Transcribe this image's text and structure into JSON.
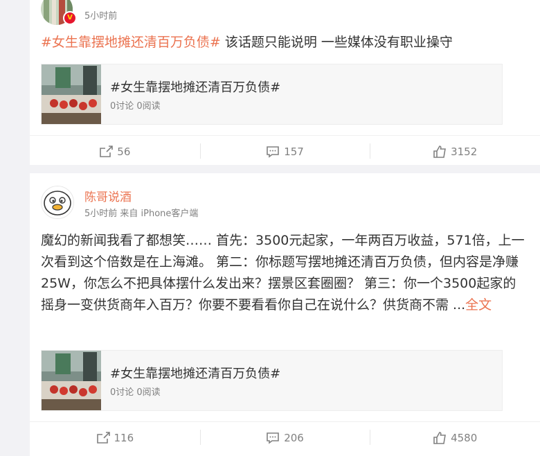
{
  "post1": {
    "time": "5小时前",
    "topic": "#女生靠摆地摊还清百万负债#",
    "text": " 该话题只能说明 一些媒体没有职业操守",
    "card": {
      "title": "#女生靠摆地摊还清百万负债#",
      "sub": "0讨论 0阅读"
    },
    "actions": {
      "repost": "56",
      "comment": "157",
      "like": "3152"
    }
  },
  "post2": {
    "author": "陈哥说酒",
    "time": "5小时前 来自 iPhone客户端",
    "text": "魔幻的新闻我看了都想笑…… 首先：3500元起家，一年两百万收益，571倍，上一次看到这个倍数是在上海滩。 第二：你标题写摆地摊还清百万负债，但内容是净赚25W，你怎么不把具体摆什么发出来？摆景区套圈圈？ 第三：你一个3500起家的摇身一变供货商年入百万？你要不要看看你自己在说什么？供货商不需 ...",
    "more": "全文",
    "card": {
      "title": "#女生靠摆地摊还清百万负债#",
      "sub": "0讨论 0阅读"
    },
    "actions": {
      "repost": "116",
      "comment": "206",
      "like": "4580"
    }
  },
  "icons": {
    "repost": "share-arrow-icon",
    "comment": "comment-bubble-icon",
    "like": "thumbs-up-icon"
  },
  "colors": {
    "accent": "#eb7350",
    "background": "#f2f2f5",
    "muted": "#808080"
  }
}
